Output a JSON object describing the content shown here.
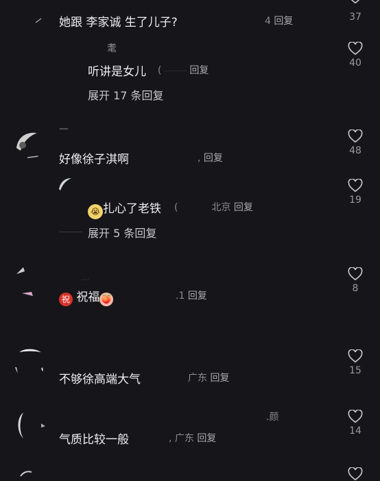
{
  "comments": [
    {
      "text": "她跟 李家诚 生了儿子?",
      "meta_num": "4",
      "reply": "回复",
      "likes": "37"
    },
    {
      "text": "听讲是女儿",
      "meta_num": "(",
      "reply": "回复",
      "likes": "40",
      "username": "耄",
      "expand": "展开 17 条回复"
    },
    {
      "text": "好像徐子淇啊",
      "meta_num": "",
      "reply": "回复",
      "likes": "48",
      "username": "—"
    },
    {
      "text": "扎心了老铁",
      "meta_num": "(",
      "location": "北京",
      "reply": "回复",
      "likes": "19",
      "expand": "展开 5 条回复"
    },
    {
      "text": "祝福",
      "meta_num": ".1",
      "reply": "回复",
      "likes": "8",
      "emoji_badge": "祝",
      "emoji_face": "🍑",
      "username": "..."
    },
    {
      "text": "不够徐高端大气",
      "location": "广东",
      "reply": "回复",
      "likes": "15"
    },
    {
      "text": "气质比较一般",
      "location": "广东",
      "reply": "回复",
      "likes": "14",
      "username": "颜"
    }
  ],
  "colors": {
    "background": "#16161a",
    "text": "#eeeeef",
    "meta": "#8a8a90"
  },
  "icons": {
    "like": "heart-outline-icon"
  }
}
